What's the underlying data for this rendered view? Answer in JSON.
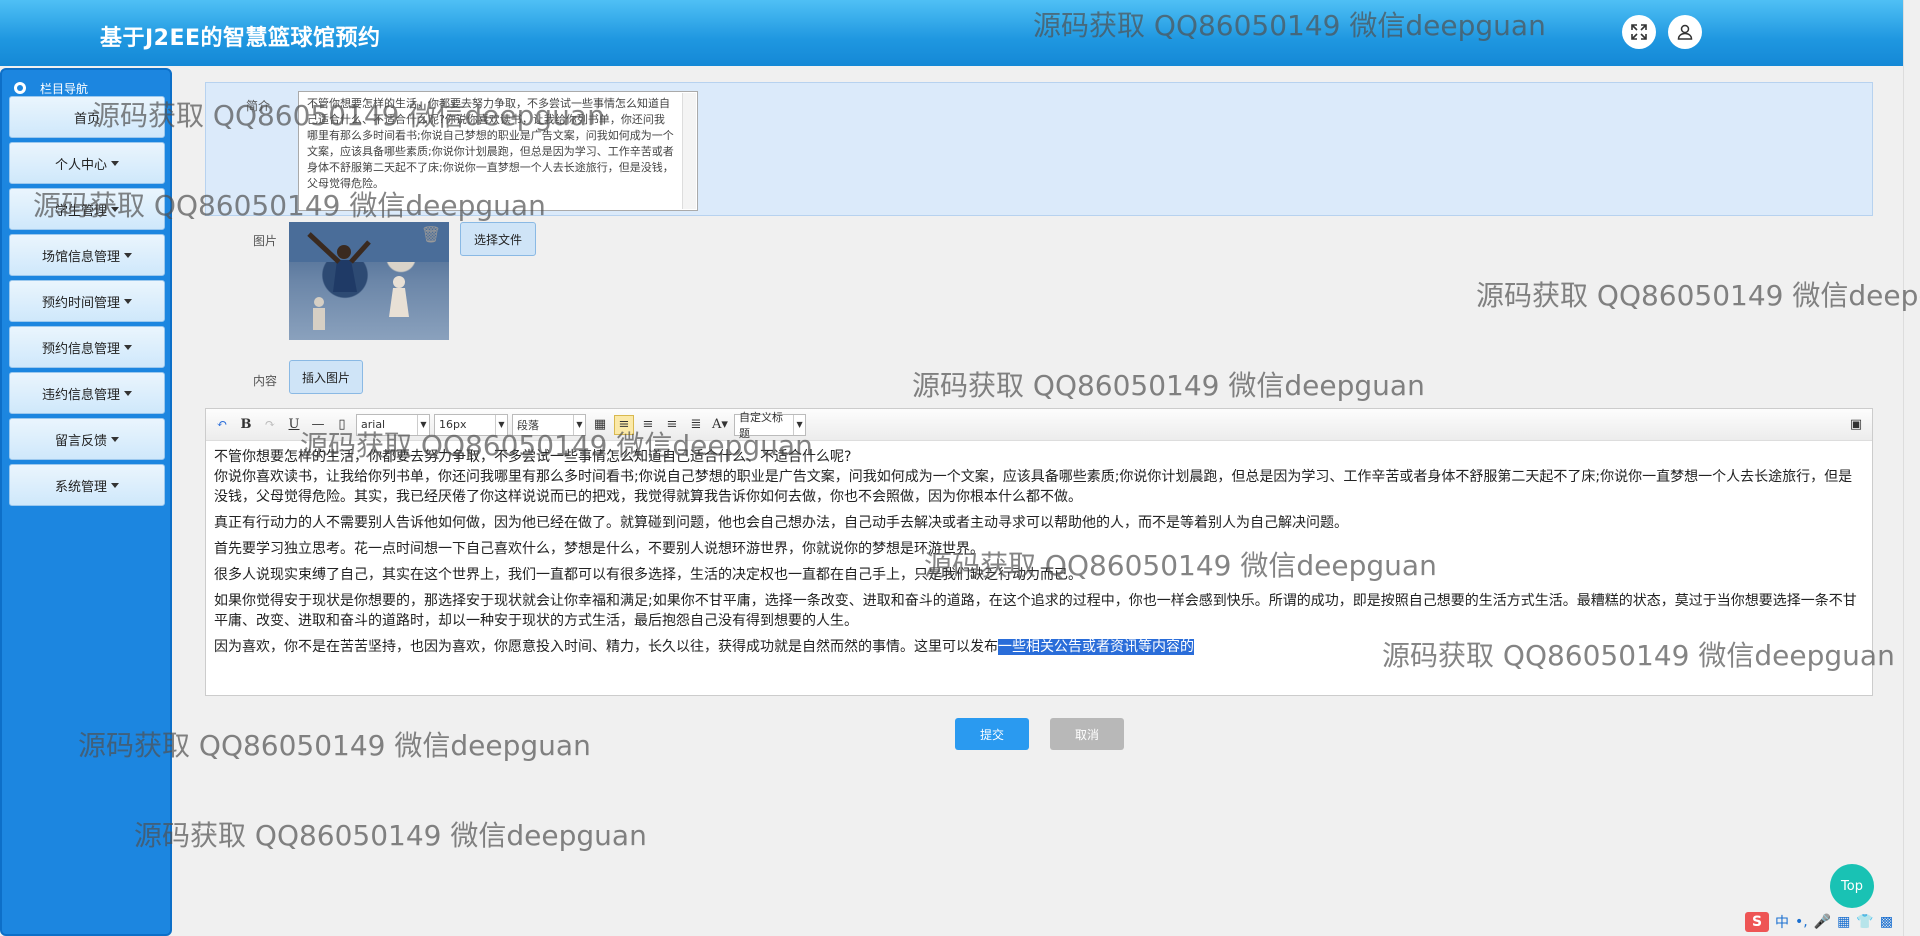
{
  "header": {
    "title": "基于J2EE的智慧篮球馆预约",
    "fullscreen_icon": "expand-icon",
    "user_icon": "user-icon"
  },
  "sidebar": {
    "heading": "栏目导航",
    "items": [
      {
        "label": "首页",
        "has_caret": false
      },
      {
        "label": "个人中心",
        "has_caret": true
      },
      {
        "label": "学生管理",
        "has_caret": true
      },
      {
        "label": "场馆信息管理",
        "has_caret": true
      },
      {
        "label": "预约时间管理",
        "has_caret": true
      },
      {
        "label": "预约信息管理",
        "has_caret": true
      },
      {
        "label": "违约信息管理",
        "has_caret": true
      },
      {
        "label": "留言反馈",
        "has_caret": true
      },
      {
        "label": "系统管理",
        "has_caret": true
      }
    ]
  },
  "form": {
    "intro_label": "简介",
    "intro_text": "不管你想要怎样的生活，你都要去努力争取，不多尝试一些事情怎么知道自己适合什么、不适合什么呢?你说你喜欢读书，让我给你列书单，你还问我哪里有那么多时间看书;你说自己梦想的职业是广告文案，问我如何成为一个文案，应该具备哪些素质;你说你计划晨跑，但总是因为学习、工作辛苦或者身体不舒服第二天起不了床;你说你一直梦想一个人去长途旅行，但是没钱，父母觉得危险。",
    "image_label": "图片",
    "choose_file": "选择文件",
    "content_label": "内容",
    "insert_image": "插入图片",
    "submit": "提交",
    "cancel": "取消"
  },
  "editor": {
    "font_family": "arial",
    "font_size": "16px",
    "paragraph": "段落",
    "custom_title": "自定义标题",
    "paragraphs": [
      "不管你想要怎样的生活，你都要去努力争取，不多尝试一些事情怎么知道自己适合什么、不适合什么呢?",
      "你说你喜欢读书，让我给你列书单，你还问我哪里有那么多时间看书;你说自己梦想的职业是广告文案，问我如何成为一个文案，应该具备哪些素质;你说你计划晨跑，但总是因为学习、工作辛苦或者身体不舒服第二天起不了床;你说你一直梦想一个人去长途旅行，但是没钱，父母觉得危险。其实，我已经厌倦了你这样说说而已的把戏，我觉得就算我告诉你如何去做，你也不会照做，因为你根本什么都不做。",
      "真正有行动力的人不需要别人告诉他如何做，因为他已经在做了。就算碰到问题，他也会自己想办法，自己动手去解决或者主动寻求可以帮助他的人，而不是等着别人为自己解决问题。",
      "首先要学习独立思考。花一点时间想一下自己喜欢什么，梦想是什么，不要别人说想环游世界，你就说你的梦想是环游世界。",
      "很多人说现实束缚了自己，其实在这个世界上，我们一直都可以有很多选择，生活的决定权也一直都在自己手上，只是我们缺乏行动力而已。",
      "如果你觉得安于现状是你想要的，那选择安于现状就会让你幸福和满足;如果你不甘平庸，选择一条改变、进取和奋斗的道路，在这个追求的过程中，你也一样会感到快乐。所谓的成功，即是按照自己想要的生活方式生活。最糟糕的状态，莫过于当你想要选择一条不甘平庸、改变、进取和奋斗的道路时，却以一种安于现状的方式生活，最后抱怨自己没有得到想要的人生。"
    ],
    "last_paragraph_plain": "因为喜欢，你不是在苦苦坚持，也因为喜欢，你愿意投入时间、精力，长久以往，获得成功就是自然而然的事情。这里可以发布",
    "last_paragraph_selected": "一些相关公告或者资讯等内容的"
  },
  "watermark": "源码获取 QQ86050149 微信deepguan",
  "top_button": "Top",
  "ime": {
    "logo": "S",
    "lang": "中"
  }
}
